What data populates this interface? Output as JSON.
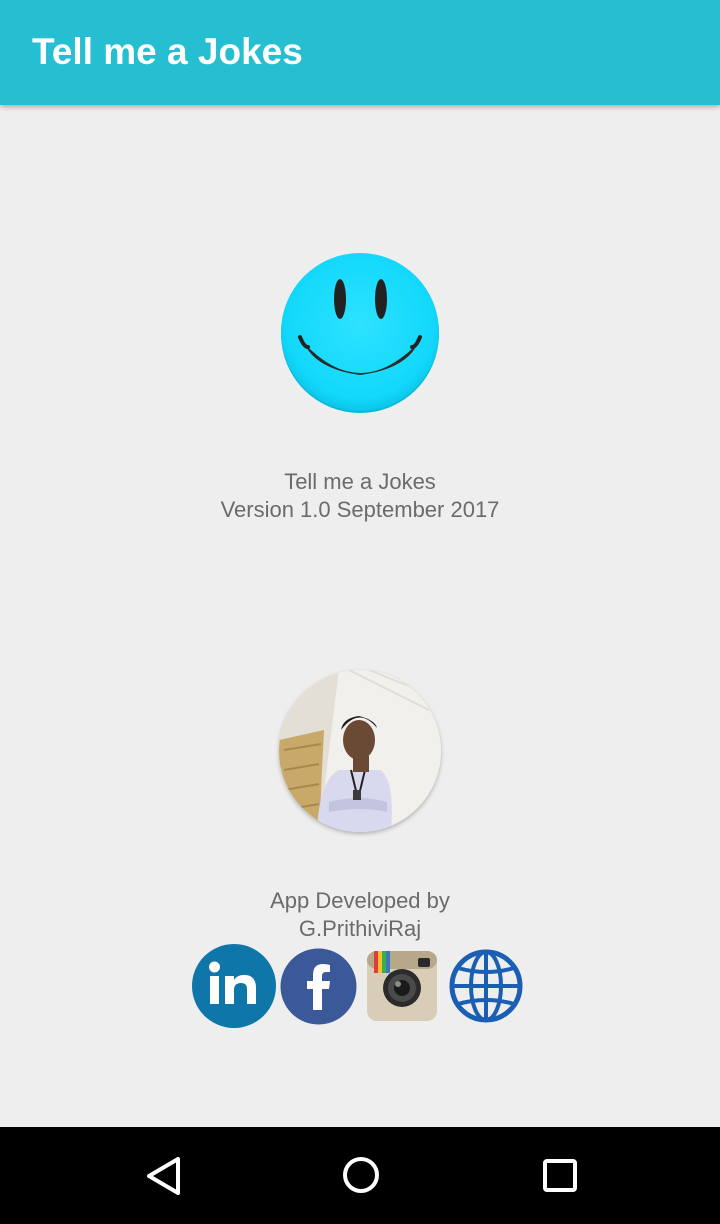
{
  "app_bar": {
    "title": "Tell me a Jokes",
    "color": "#26bfd1"
  },
  "about": {
    "logo_icon": "smiley-face-icon",
    "app_name": "Tell me a Jokes",
    "version": "Version 1.0 September 2017"
  },
  "developer": {
    "photo": "developer-photo",
    "line1": "App Developed by",
    "line2": "G.PrithiviRaj"
  },
  "social_links": [
    {
      "icon": "linkedin-icon",
      "color": "#0e76a8"
    },
    {
      "icon": "facebook-icon",
      "color": "#3b5998"
    },
    {
      "icon": "instagram-icon",
      "color": "#d6cbb5"
    },
    {
      "icon": "globe-icon",
      "color": "#1a5fb4"
    }
  ],
  "nav_bar": {
    "back_icon": "back-triangle-icon",
    "home_icon": "home-circle-icon",
    "recents_icon": "recents-square-icon"
  }
}
